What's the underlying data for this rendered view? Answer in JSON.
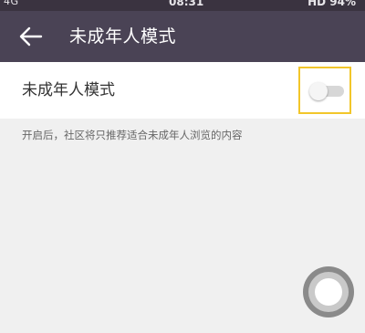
{
  "status_bar": {
    "left_text": "4G",
    "time": "08:31",
    "right_text": "HD 94%"
  },
  "app_bar": {
    "back_icon": "arrow-left-icon",
    "title": "未成年人模式"
  },
  "setting": {
    "label": "未成年人模式",
    "toggle_on": false
  },
  "hint_text": "开启后，社区将只推荐适合未成年人浏览的内容",
  "colors": {
    "app_bar": "#4a4355",
    "status_bar": "#3a3340",
    "background": "#f0f0f0",
    "highlight": "#f2c62a"
  },
  "floating_button_icon": "assistive-touch-icon"
}
